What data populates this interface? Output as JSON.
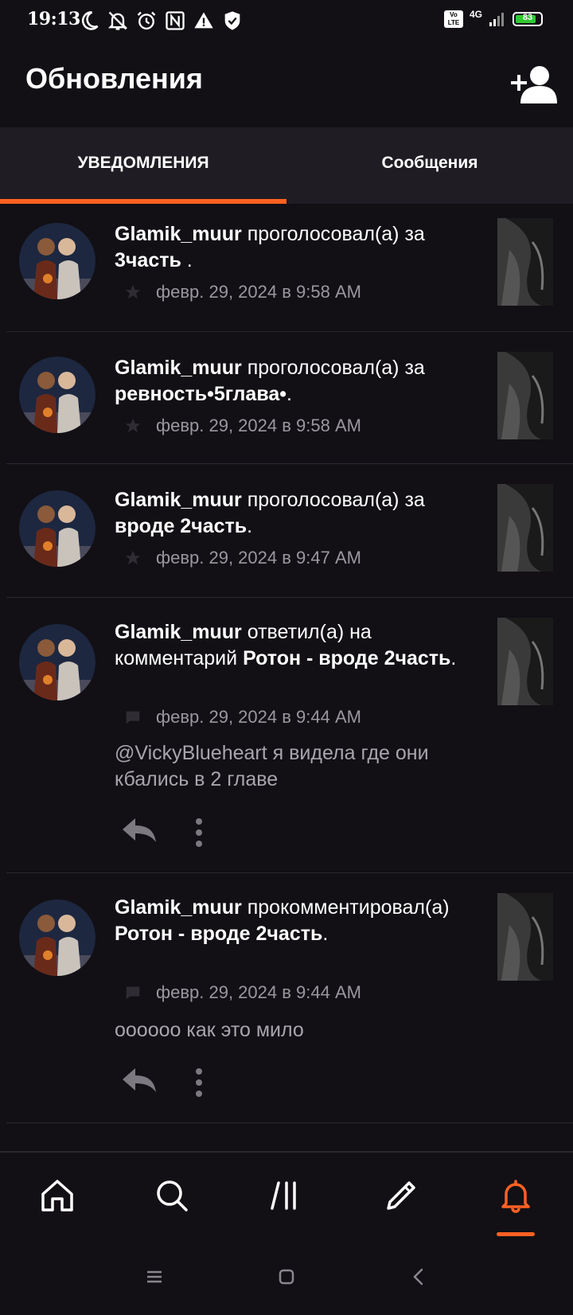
{
  "status_bar": {
    "time": "19:13",
    "icons": [
      "moon-icon",
      "bell-off-icon",
      "alarm-icon",
      "nfc-icon",
      "warning-icon",
      "shield-icon"
    ],
    "volte": "Vo LTE",
    "network": "4G",
    "battery": "83",
    "battery_level": 0.83
  },
  "header": {
    "title": "Обновления",
    "action_icon": "add-user-icon"
  },
  "tabs": [
    {
      "label": "УВЕДОМЛЕНИЯ",
      "active": true
    },
    {
      "label": "Сообщения",
      "active": false
    }
  ],
  "notifications": [
    {
      "user": "Glamik_muur",
      "action": "проголосовал(а) за",
      "target": "3часть",
      "suffix": " .",
      "type_icon": "star-icon",
      "time": "февр. 29, 2024 в 9:58 AM"
    },
    {
      "user": "Glamik_muur",
      "action": "проголосовал(а) за",
      "target": "ревность•5глава•",
      "suffix": ".",
      "type_icon": "star-icon",
      "time": "февр. 29, 2024 в 9:58 AM"
    },
    {
      "user": "Glamik_muur",
      "action": "проголосовал(а) за",
      "target": "вроде 2часть",
      "suffix": ".",
      "type_icon": "star-icon",
      "time": "февр. 29, 2024 в 9:47 AM"
    },
    {
      "user": "Glamik_muur",
      "action": "ответил(а) на комментарий",
      "target": "Ротон - вроде 2часть",
      "suffix": ".",
      "type_icon": "comment-icon",
      "time": "февр. 29, 2024 в 9:44 AM",
      "comment": "@VickyBlueheart я видела где они кбались в 2 главе"
    },
    {
      "user": "Glamik_muur",
      "action": "прокомментировал(а)",
      "target": "Ротон - вроде 2часть",
      "suffix": ".",
      "type_icon": "comment-icon",
      "time": "февр. 29, 2024 в 9:44 AM",
      "comment": "оооооо как это мило"
    }
  ],
  "bottom_nav": [
    {
      "icon": "home-icon",
      "active": false
    },
    {
      "icon": "search-icon",
      "active": false
    },
    {
      "icon": "library-icon",
      "active": false
    },
    {
      "icon": "write-icon",
      "active": false
    },
    {
      "icon": "notifications-bell-icon",
      "active": true
    }
  ],
  "system_nav": [
    "menu-icon",
    "home-square-icon",
    "back-icon"
  ],
  "colors": {
    "accent": "#ff6122",
    "background": "#121015",
    "tab_bar": "#1f1d23",
    "secondary_text": "#9b979f"
  }
}
